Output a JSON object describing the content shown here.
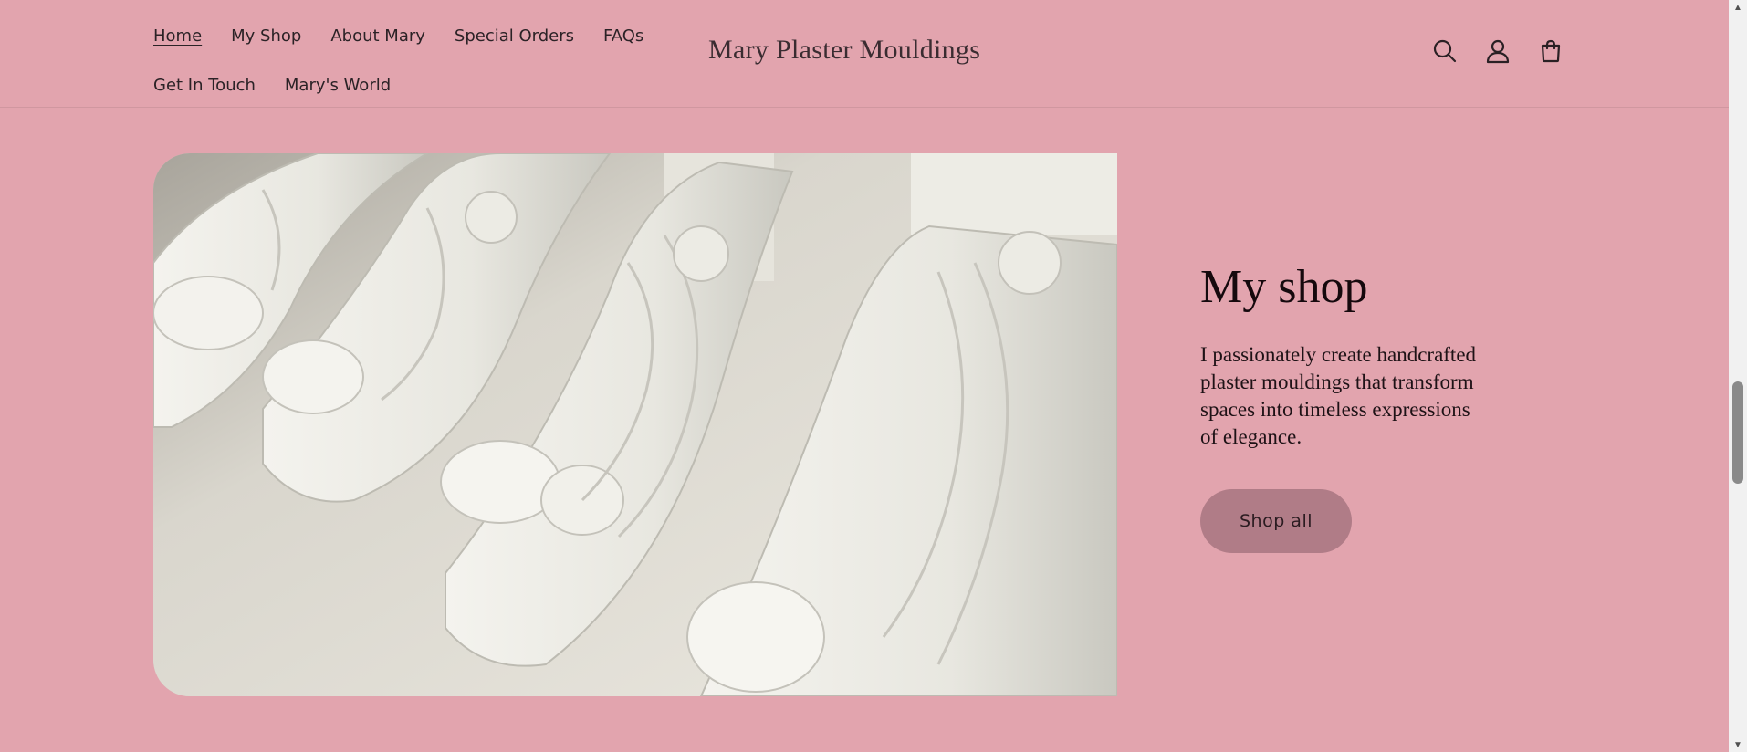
{
  "nav": {
    "row1": [
      "Home",
      "My Shop",
      "About Mary",
      "Special Orders",
      "FAQs"
    ],
    "row2": [
      "Get In Touch",
      "Mary's World"
    ],
    "active": "Home"
  },
  "brand": "Mary Plaster Mouldings",
  "header_icons": [
    "search-icon",
    "account-icon",
    "cart-icon"
  ],
  "hero": {
    "title": "My shop",
    "description": "I passionately create handcrafted plaster mouldings that transform spaces into timeless expressions of elegance.",
    "button_label": "Shop all"
  },
  "colors": {
    "background": "#e2a4ae",
    "button": "#b07c87",
    "text": "#1e1216"
  }
}
